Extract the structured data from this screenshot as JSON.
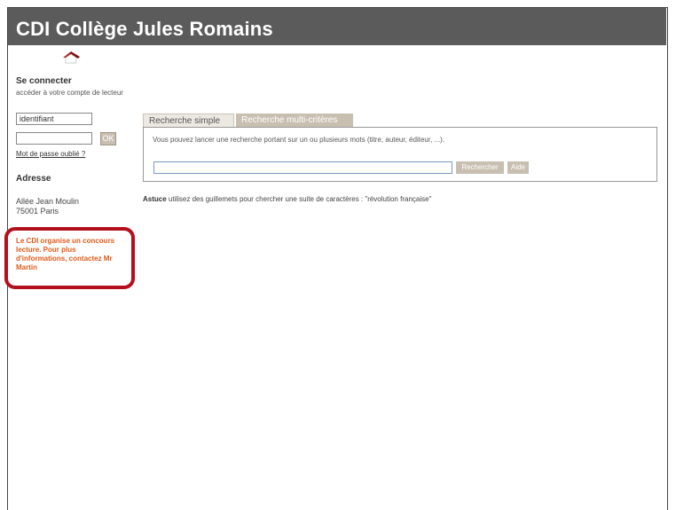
{
  "header": {
    "title": "CDI Collège Jules Romains"
  },
  "login": {
    "title": "Se connecter",
    "subtitle": "accéder à votre compte de lecteur",
    "username_value": "identifiant",
    "password_value": "",
    "ok_label": "OK",
    "forgot_label": "Mot de passe oublié ?"
  },
  "address": {
    "title": "Adresse",
    "line1": "Allée Jean Moulin",
    "line2": "75001 Paris"
  },
  "news": {
    "text": "Le CDI organise un concours lecture. Pour plus d'informations, contactez Mr Martin"
  },
  "search": {
    "tabs": [
      {
        "label": "Recherche simple"
      },
      {
        "label": "Recherche multi-critères"
      }
    ],
    "description": "Vous pouvez lancer une recherche portant sur un ou plusieurs mots (titre, auteur, éditeur, ...).",
    "query_value": "",
    "search_label": "Rechercher",
    "help_label": "Aide"
  },
  "tip": {
    "label": "Astuce",
    "text": " utilisez des guillemets pour chercher une suite de caractères : \"révolution française\""
  },
  "colors": {
    "header_bg": "#5b5b5b",
    "button_bg": "#c9bfb1",
    "news_text": "#e05a1a",
    "highlight_outline": "#b40f1c"
  },
  "icons": {
    "logo": "house-roof-icon"
  }
}
